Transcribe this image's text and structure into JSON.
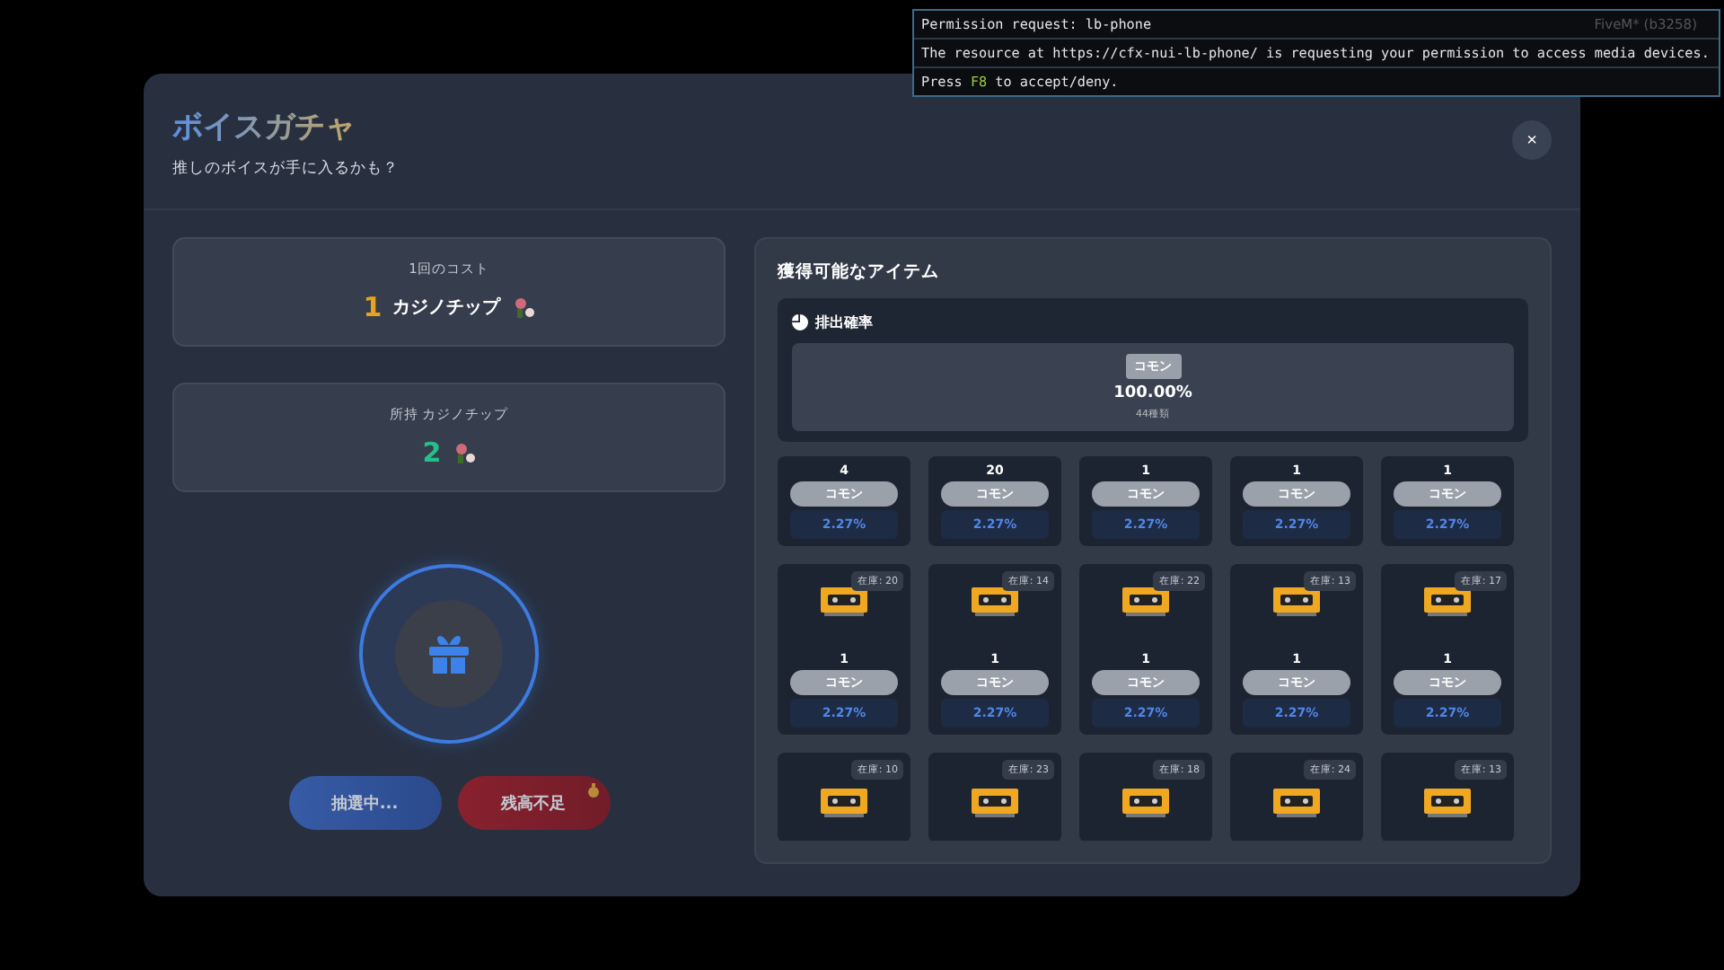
{
  "permission": {
    "title": "Permission request: lb-phone",
    "message": "The resource at https://cfx-nui-lb-phone/ is requesting your permission to access media devices.",
    "hint_before": "Press",
    "key": "F8",
    "hint_after": "to accept/deny.",
    "build": "FiveM* (b3258)"
  },
  "modal": {
    "title": "ボイスガチャ",
    "subtitle": "推しのボイスが手に入るかも？",
    "close": "×"
  },
  "cost": {
    "label": "1回のコスト",
    "amount": "1",
    "unit": "カジノチップ"
  },
  "balance": {
    "label": "所持 カジノチップ",
    "amount": "2"
  },
  "buttons": [
    {
      "label": "抽選中...",
      "kind": "draw",
      "disabled": true
    },
    {
      "label": "残高不足",
      "kind": "insufficient",
      "disabled": true
    }
  ],
  "items_panel": {
    "title": "獲得可能なアイテム",
    "odds_title": "排出確率",
    "odds": [
      {
        "rarity": "コモン",
        "rate": "100.00%",
        "count": "44種類"
      }
    ]
  },
  "items": [
    {
      "count": "4",
      "rarity": "コモン",
      "rate": "2.27%"
    },
    {
      "count": "20",
      "rarity": "コモン",
      "rate": "2.27%"
    },
    {
      "count": "1",
      "rarity": "コモン",
      "rate": "2.27%"
    },
    {
      "count": "1",
      "rarity": "コモン",
      "rate": "2.27%"
    },
    {
      "count": "1",
      "rarity": "コモン",
      "rate": "2.27%"
    },
    {
      "stock": "在庫: 20",
      "count": "1",
      "rarity": "コモン",
      "rate": "2.27%"
    },
    {
      "stock": "在庫: 14",
      "count": "1",
      "rarity": "コモン",
      "rate": "2.27%"
    },
    {
      "stock": "在庫: 22",
      "count": "1",
      "rarity": "コモン",
      "rate": "2.27%"
    },
    {
      "stock": "在庫: 13",
      "count": "1",
      "rarity": "コモン",
      "rate": "2.27%"
    },
    {
      "stock": "在庫: 17",
      "count": "1",
      "rarity": "コモン",
      "rate": "2.27%"
    },
    {
      "stock": "在庫: 10"
    },
    {
      "stock": "在庫: 23"
    },
    {
      "stock": "在庫: 18"
    },
    {
      "stock": "在庫: 24"
    },
    {
      "stock": "在庫: 13"
    }
  ]
}
